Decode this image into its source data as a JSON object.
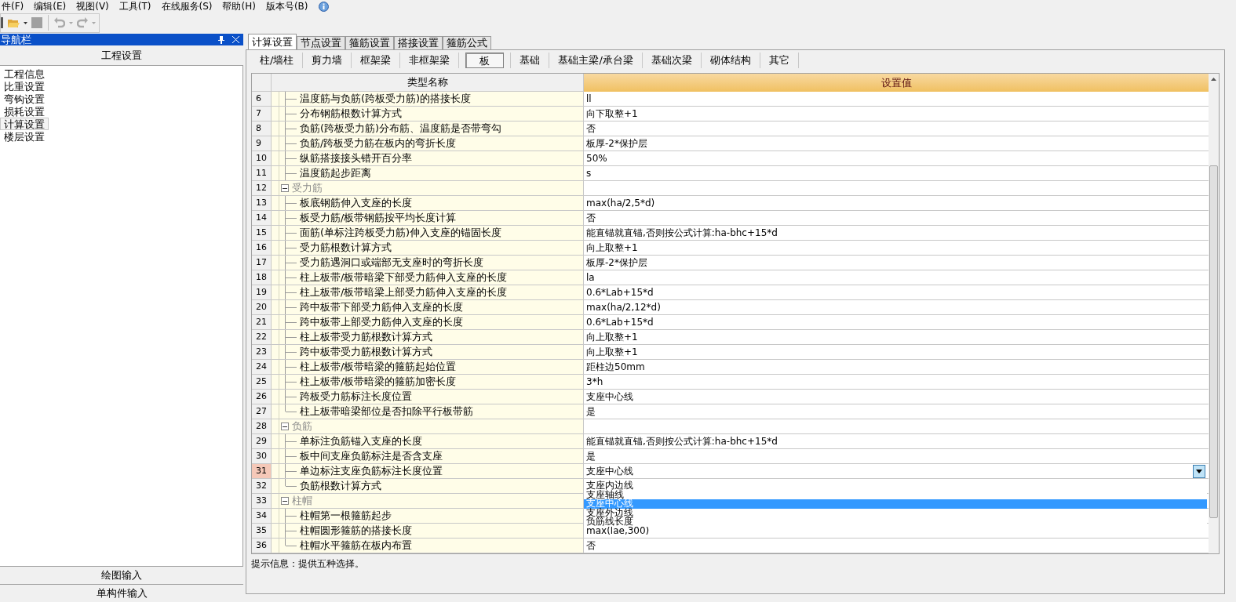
{
  "menu": [
    "件(F)",
    "编辑(E)",
    "视图(V)",
    "工具(T)",
    "在线服务(S)",
    "帮助(H)",
    "版本号(B)"
  ],
  "nav": {
    "title": "导航栏",
    "section": "工程设置",
    "items": [
      {
        "label": "工程信息",
        "selected": false
      },
      {
        "label": "比重设置",
        "selected": false
      },
      {
        "label": "弯钩设置",
        "selected": false
      },
      {
        "label": "损耗设置",
        "selected": false
      },
      {
        "label": "计算设置",
        "selected": true
      },
      {
        "label": "楼层设置",
        "selected": false
      }
    ],
    "bottom_buttons": [
      "绘图输入",
      "单构件输入"
    ]
  },
  "tabs": [
    {
      "label": "计算设置",
      "selected": true
    },
    {
      "label": "节点设置",
      "selected": false
    },
    {
      "label": "箍筋设置",
      "selected": false
    },
    {
      "label": "搭接设置",
      "selected": false
    },
    {
      "label": "箍筋公式",
      "selected": false
    }
  ],
  "sub_tabs": [
    {
      "label": "柱/墙柱",
      "selected": false
    },
    {
      "label": "剪力墙",
      "selected": false
    },
    {
      "label": "框架梁",
      "selected": false
    },
    {
      "label": "非框架梁",
      "selected": false
    },
    {
      "label": "板",
      "selected": true
    },
    {
      "label": "基础",
      "selected": false
    },
    {
      "label": "基础主梁/承台梁",
      "selected": false
    },
    {
      "label": "基础次梁",
      "selected": false
    },
    {
      "label": "砌体结构",
      "selected": false
    },
    {
      "label": "其它",
      "selected": false
    }
  ],
  "table": {
    "columns": [
      "类型名称",
      "设置值"
    ],
    "rows": [
      {
        "kind": "item",
        "number": "6",
        "name": "温度筋与负筋(跨板受力筋)的搭接长度",
        "value": "ll",
        "selected": false
      },
      {
        "kind": "item",
        "number": "7",
        "name": "分布钢筋根数计算方式",
        "value": "向下取整+1",
        "selected": false
      },
      {
        "kind": "item",
        "number": "8",
        "name": "负筋(跨板受力筋)分布筋、温度筋是否带弯勾",
        "value": "否",
        "selected": false
      },
      {
        "kind": "item",
        "number": "9",
        "name": "负筋/跨板受力筋在板内的弯折长度",
        "value": "板厚-2*保护层",
        "selected": false
      },
      {
        "kind": "item",
        "number": "10",
        "name": "纵筋搭接接头错开百分率",
        "value": "50%",
        "selected": false
      },
      {
        "kind": "item",
        "number": "11",
        "name": "温度筋起步距离",
        "value": "s",
        "selected": false
      },
      {
        "kind": "group",
        "number": "12",
        "name": "受力筋",
        "expanded": true,
        "selected": false,
        "children": [
          {
            "kind": "item",
            "number": "13",
            "name": "板底钢筋伸入支座的长度",
            "value": "max(ha/2,5*d)",
            "selected": false
          },
          {
            "kind": "item",
            "number": "14",
            "name": "板受力筋/板带钢筋按平均长度计算",
            "value": "否",
            "selected": false
          },
          {
            "kind": "item",
            "number": "15",
            "name": "面筋(单标注跨板受力筋)伸入支座的锚固长度",
            "value": "能直锚就直锚,否则按公式计算:ha-bhc+15*d",
            "selected": false
          },
          {
            "kind": "item",
            "number": "16",
            "name": "受力筋根数计算方式",
            "value": "向上取整+1",
            "selected": false
          },
          {
            "kind": "item",
            "number": "17",
            "name": "受力筋遇洞口或端部无支座时的弯折长度",
            "value": "板厚-2*保护层",
            "selected": false
          },
          {
            "kind": "item",
            "number": "18",
            "name": "柱上板带/板带暗梁下部受力筋伸入支座的长度",
            "value": "la",
            "selected": false
          },
          {
            "kind": "item",
            "number": "19",
            "name": "柱上板带/板带暗梁上部受力筋伸入支座的长度",
            "value": "0.6*Lab+15*d",
            "selected": false
          },
          {
            "kind": "item",
            "number": "20",
            "name": "跨中板带下部受力筋伸入支座的长度",
            "value": "max(ha/2,12*d)",
            "selected": false
          },
          {
            "kind": "item",
            "number": "21",
            "name": "跨中板带上部受力筋伸入支座的长度",
            "value": "0.6*Lab+15*d",
            "selected": false
          },
          {
            "kind": "item",
            "number": "22",
            "name": "柱上板带受力筋根数计算方式",
            "value": "向上取整+1",
            "selected": false
          },
          {
            "kind": "item",
            "number": "23",
            "name": "跨中板带受力筋根数计算方式",
            "value": "向上取整+1",
            "selected": false
          },
          {
            "kind": "item",
            "number": "24",
            "name": "柱上板带/板带暗梁的箍筋起始位置",
            "value": "距柱边50mm",
            "selected": false
          },
          {
            "kind": "item",
            "number": "25",
            "name": "柱上板带/板带暗梁的箍筋加密长度",
            "value": "3*h",
            "selected": false
          },
          {
            "kind": "item",
            "number": "26",
            "name": "跨板受力筋标注长度位置",
            "value": "支座中心线",
            "selected": false
          },
          {
            "kind": "item",
            "number": "27",
            "name": "柱上板带暗梁部位是否扣除平行板带筋",
            "value": "是",
            "selected": false
          }
        ]
      },
      {
        "kind": "group",
        "number": "28",
        "name": "负筋",
        "expanded": true,
        "selected": false,
        "children": [
          {
            "kind": "item",
            "number": "29",
            "name": "单标注负筋锚入支座的长度",
            "value": "能直锚就直锚,否则按公式计算:ha-bhc+15*d",
            "selected": false
          },
          {
            "kind": "item",
            "number": "30",
            "name": "板中间支座负筋标注是否含支座",
            "value": "是",
            "selected": false
          },
          {
            "kind": "item",
            "number": "31",
            "name": "单边标注支座负筋标注长度位置",
            "value": "支座中心线",
            "selected": true,
            "dropdown": {
              "expanded": true,
              "options": [
                {
                  "label": "支座内边线",
                  "selected": false
                },
                {
                  "label": "支座轴线",
                  "selected": false
                },
                {
                  "label": "支座中心线",
                  "selected": true
                },
                {
                  "label": "支座外边线",
                  "selected": false
                },
                {
                  "label": "负筋线长度",
                  "selected": false
                }
              ]
            }
          },
          {
            "kind": "item",
            "number": "32",
            "name": "负筋根数计算方式",
            "selected": false
          }
        ]
      },
      {
        "kind": "group",
        "number": "33",
        "name": "柱帽",
        "expanded": true,
        "selected": false,
        "children": [
          {
            "kind": "item",
            "number": "34",
            "name": "柱帽第一根箍筋起步",
            "selected": false
          },
          {
            "kind": "item",
            "number": "35",
            "name": "柱帽圆形箍筋的搭接长度",
            "value": "max(lae,300)",
            "selected": false
          },
          {
            "kind": "item",
            "number": "36",
            "name": "柱帽水平箍筋在板内布置",
            "value": "否",
            "selected": false
          }
        ]
      }
    ]
  },
  "hint": "提示信息：提供五种选择。"
}
